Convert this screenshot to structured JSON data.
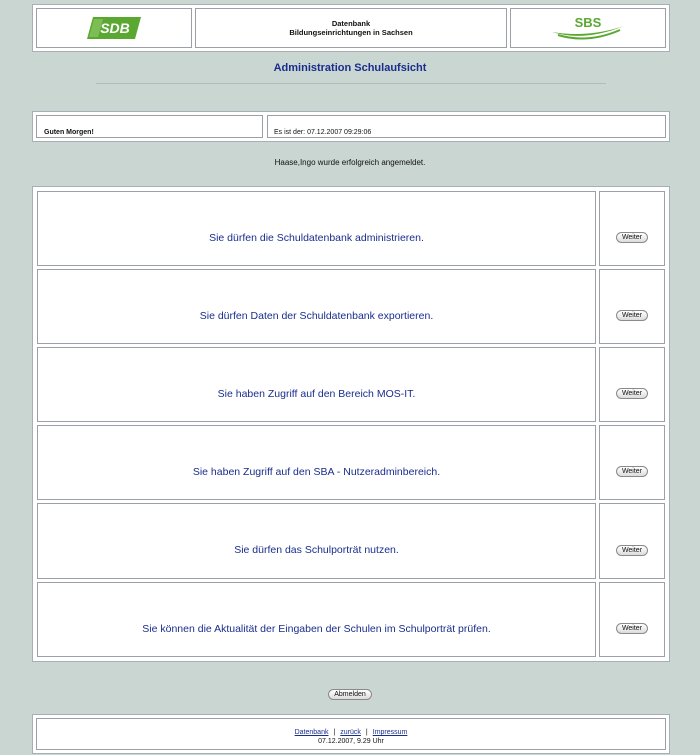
{
  "header": {
    "logo_left_text": "SDB",
    "logo_right_text": "SBS",
    "title_line1": "Datenbank",
    "title_line2": "Bildungseinrichtungen in Sachsen",
    "logo_green": "#5aa832"
  },
  "page_title": "Administration Schulaufsicht",
  "greeting": {
    "left": "Guten Morgen!",
    "right": "Es ist der: 07.12.2007 09:29:06"
  },
  "login_message": "Haase,Ingo wurde erfolgreich angemeldet.",
  "permissions": [
    {
      "text": "Sie dürfen die Schuldatenbank administrieren.",
      "button": "Weiter"
    },
    {
      "text": "Sie dürfen Daten der Schuldatenbank exportieren.",
      "button": "Weiter"
    },
    {
      "text": "Sie haben Zugriff auf den Bereich MOS-IT.",
      "button": "Weiter"
    },
    {
      "text": "Sie haben Zugriff auf den SBA - Nutzeradminbereich.",
      "button": "Weiter"
    },
    {
      "text": "Sie dürfen das Schulporträt nutzen.",
      "button": "Weiter"
    },
    {
      "text": "Sie können die Aktualität der Eingaben der Schulen im Schulporträt prüfen.",
      "button": "Weiter"
    }
  ],
  "logout_button": "Abmelden",
  "footer": {
    "links": [
      "Datenbank",
      "zurück",
      "Impressum"
    ],
    "separator": "|",
    "timestamp": "07.12.2007, 9.29 Uhr"
  },
  "colors": {
    "background": "#cad6d2",
    "title_blue": "#1a2d8c"
  }
}
